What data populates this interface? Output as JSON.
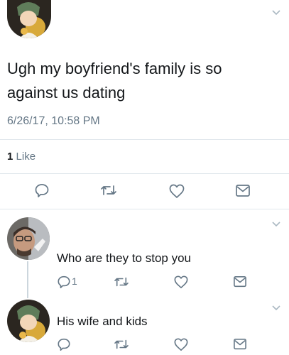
{
  "main_tweet": {
    "text_line1": "Ugh my boyfriend's family is so",
    "text_line2": "against us dating",
    "timestamp": "6/26/17, 10:58 PM",
    "likes_count": "1",
    "likes_label": "Like"
  },
  "reply1": {
    "text": "Who are they to stop you",
    "reply_count": "1"
  },
  "reply2": {
    "text": "His wife and kids"
  },
  "icons": [
    "chevron-down-icon",
    "reply-icon",
    "retweet-icon",
    "like-icon",
    "share-icon"
  ],
  "colors": {
    "text": "#14171a",
    "muted": "#657786",
    "icon": "#657786",
    "divider": "#e1e8ed"
  }
}
